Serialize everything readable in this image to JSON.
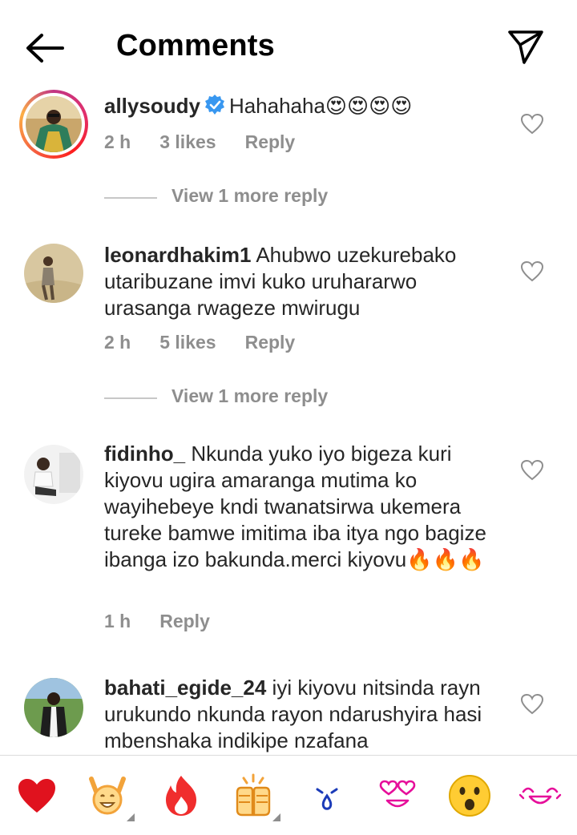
{
  "header": {
    "title": "Comments",
    "back_icon": "arrow-left-icon",
    "send_icon": "paper-plane-icon"
  },
  "comments": [
    {
      "username": "allysoudy",
      "verified": true,
      "text": "Hahahaha😍😍😍😍",
      "time": "2 h",
      "likes": "3 likes",
      "reply": "Reply",
      "view_more": "View 1 more reply"
    },
    {
      "username": "leonardhakim1",
      "verified": false,
      "text": "Ahubwo uzekurebako utaribuzane imvi kuko uruhararwo urasanga rwageze mwirugu",
      "time": "2 h",
      "likes": "5 likes",
      "reply": "Reply",
      "view_more": "View 1 more reply"
    },
    {
      "username": "fidinho_",
      "verified": false,
      "text": "Nkunda yuko iyo bigeza kuri kiyovu ugira amaranga mutima ko wayihebeye kndi twanatsirwa ukemera tureke bamwe imitima iba itya ngo bagize ibanga izo bakunda.merci kiyovu🔥🔥🔥",
      "time": "1 h",
      "reply": "Reply"
    },
    {
      "username": "bahati_egide_24",
      "verified": false,
      "text": "iyi kiyovu nitsinda rayn urukundo nkunda rayon ndarushyira hasi mbenshaka indikipe nzafana"
    }
  ],
  "emoji_bar": [
    "red-heart",
    "raising-hands",
    "fire",
    "clapping-hands",
    "crying-face",
    "heart-eyes",
    "astonished-face",
    "laughing-face"
  ]
}
